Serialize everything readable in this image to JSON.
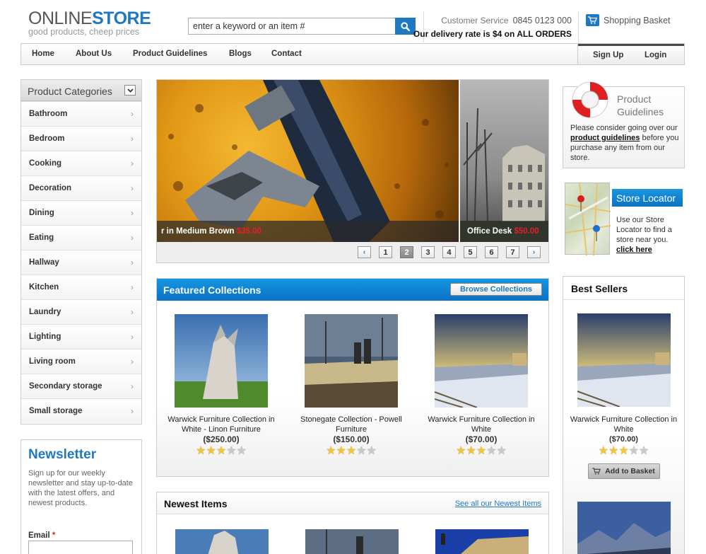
{
  "header": {
    "logo_part1": "ONLINE",
    "logo_part2": "STORE",
    "tagline": "good products, cheep prices",
    "search_placeholder": "enter a keyword or an item #",
    "customer_service_label": "Customer Service",
    "customer_service_phone": "0845 0123 000",
    "delivery_text": "Our delivery rate is $4 on ALL ORDERS",
    "basket_label": "Shopping Basket"
  },
  "nav": {
    "items": [
      "Home",
      "About Us",
      "Product Guidelines",
      "Blogs",
      "Contact"
    ],
    "signup": "Sign Up",
    "login": "Login"
  },
  "categories": {
    "title": "Product Categories",
    "items": [
      "Bathroom",
      "Bedroom",
      "Cooking",
      "Decoration",
      "Dining",
      "Eating",
      "Hallway",
      "Kitchen",
      "Laundry",
      "Lighting",
      "Living room",
      "Secondary storage",
      "Small storage"
    ]
  },
  "newsletter": {
    "title": "Newsletter",
    "text": "Sign up for our weekly newsletter and stay up-to-date with the latest offers, and newest products.",
    "email_label": "Email",
    "required_mark": "*"
  },
  "slider": {
    "slides": [
      {
        "name": "r in Medium Brown",
        "price": "$35.00"
      },
      {
        "name": "Office Desk",
        "price": "$50.00"
      }
    ],
    "pages": [
      "1",
      "2",
      "3",
      "4",
      "5",
      "6",
      "7"
    ],
    "active_page": "2",
    "prev": "‹",
    "next": "›"
  },
  "featured": {
    "title": "Featured Collections",
    "button": "Browse Collections",
    "products": [
      {
        "name": "Warwick Furniture Collection in White - Linon Furniture",
        "price": "($250.00)",
        "rating": 3
      },
      {
        "name": "Stonegate Collection - Powell Furniture",
        "price": "($150.00)",
        "rating": 3
      },
      {
        "name": "Warwick Furniture Collection in White",
        "price": "($70.00)",
        "rating": 3
      }
    ]
  },
  "newest": {
    "title": "Newest Items",
    "link": "See all our Newest Items"
  },
  "guidelines": {
    "title_line1": "Product",
    "title_line2": "Guidelines",
    "text_before": "Please consider going over our ",
    "link": "product guidelines",
    "text_after": " before you purchase any item from our store."
  },
  "locator": {
    "title": "Store Locator",
    "text": "Use our Store Locator to find a store near you.",
    "link": "click here"
  },
  "bestsellers": {
    "title": "Best Sellers",
    "product_name": "Warwick Furniture Collection in White",
    "product_price": "($70.00)",
    "rating": 3,
    "button": "Add to Basket"
  },
  "colors": {
    "brand_blue": "#1e78c2",
    "price_red": "#e4202b",
    "star_gold": "#f2c53a"
  }
}
